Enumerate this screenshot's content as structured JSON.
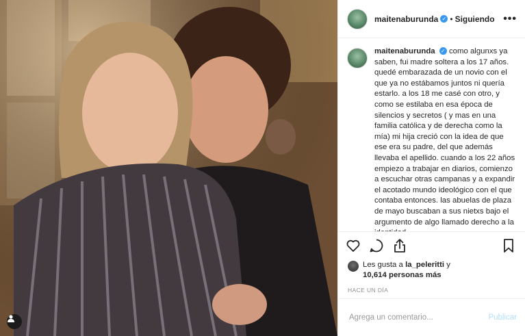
{
  "post": {
    "username": "maitenaburunda",
    "verified_icon": "verified-badge-icon",
    "following_label": "Siguiendo",
    "more_label": "•••",
    "caption_user": "maitenaburunda",
    "caption_text": "como algunxs ya saben, fui madre soltera a los 17 años. quedé embarazada de un novio con el que ya no estábamos juntos ni quería estarlo. a los 18 me casé con otro, y como se estilaba en esa época de silencios y secretos ( y mas en una familia católica y de derecha como la mía) mi hija creció con la idea de que ese era su padre, del que además llevaba el apellido. cuando a los 22 años empiezo a trabajar en diarios, comienzo a escuchar otras campanas y a expandir el acotado mundo ideológico con el que contaba entonces. las abuelas de plaza de mayo buscaban a sus nietxs bajo el argumento de algo llamado derecho a la identidad...",
    "likes_prefix": "Les gusta a ",
    "likes_user": "la_peleritti",
    "likes_suffix": " y",
    "likes_count": "10,614 personas más",
    "timestamp": "HACE UN DÍA",
    "comment_placeholder": "Agrega un comentario...",
    "publish_label": "Publicar",
    "colors": {
      "accent": "#3897f0",
      "publish": "#b2dffc",
      "border": "#efefef"
    }
  }
}
